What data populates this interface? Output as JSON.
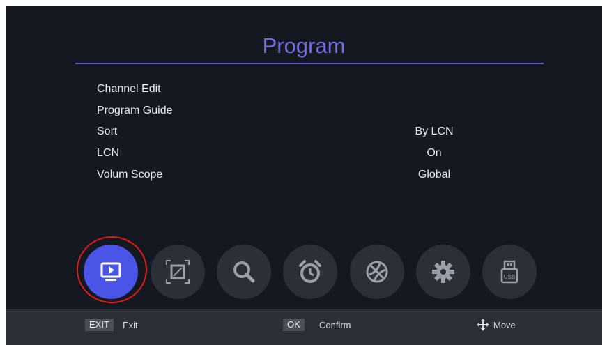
{
  "header": {
    "title": "Program"
  },
  "menu": [
    {
      "label": "Channel Edit",
      "value": ""
    },
    {
      "label": "Program Guide",
      "value": ""
    },
    {
      "label": "Sort",
      "value": "By LCN"
    },
    {
      "label": "LCN",
      "value": "On"
    },
    {
      "label": "Volum Scope",
      "value": "Global"
    }
  ],
  "icons": [
    {
      "name": "program-tv-icon",
      "active": true
    },
    {
      "name": "picture-icon",
      "active": false
    },
    {
      "name": "search-icon",
      "active": false
    },
    {
      "name": "alarm-clock-icon",
      "active": false
    },
    {
      "name": "network-ball-icon",
      "active": false
    },
    {
      "name": "gear-icon",
      "active": false
    },
    {
      "name": "usb-icon",
      "active": false
    }
  ],
  "icon_labels": {
    "usb": "USB"
  },
  "footer": {
    "exit_key": "EXIT",
    "exit_label": "Exit",
    "ok_key": "OK",
    "ok_label": "Confirm",
    "move_label": "Move"
  },
  "colors": {
    "accent": "#4a55e8",
    "title": "#6f6fe0",
    "highlight": "#e01818"
  }
}
